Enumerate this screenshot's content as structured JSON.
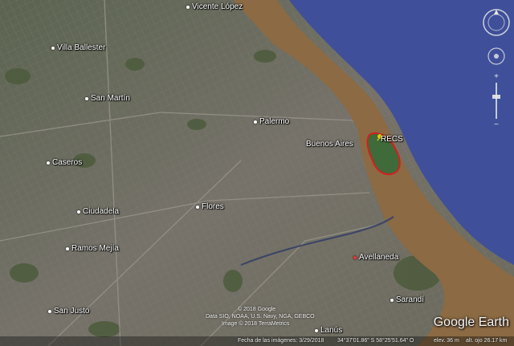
{
  "places": {
    "vicente_lopez": "Vicente López",
    "villa_ballester": "Villa Ballester",
    "san_martin": "San Martín",
    "palermo": "Palermo",
    "buenos_aires": "Buenos Aires",
    "recs": "RECS",
    "caseros": "Caseros",
    "ciudadela": "Ciudadela",
    "flores": "Flores",
    "ramos_mejia": "Ramos Mejía",
    "avellaneda": "Avellaneda",
    "san_justo": "San Justo",
    "sarandi": "Sarandí",
    "lanus": "Lanús"
  },
  "attribution": {
    "line1": "© 2018 Google",
    "line2": "Data SIO, NOAA, U.S. Navy, NGA, GEBCO",
    "line3": "Image © 2018 TerraMetrics"
  },
  "logo": "Google Earth",
  "status": {
    "imagery_date": "Fecha de las imágenes: 3/29/2018",
    "coords": "34°37'01.86\" S  58°25'51.64\" O",
    "elevation": "elev.  36 m",
    "altitude": "alt. ojo  26.17 km"
  },
  "colors": {
    "water": "#3f4f9a",
    "shore": "#8b6a44",
    "marker": "#f2d400",
    "outline": "#d21f1f"
  },
  "icons": {
    "compass": "compass-icon",
    "pin": "yellow-pushpin-icon"
  }
}
